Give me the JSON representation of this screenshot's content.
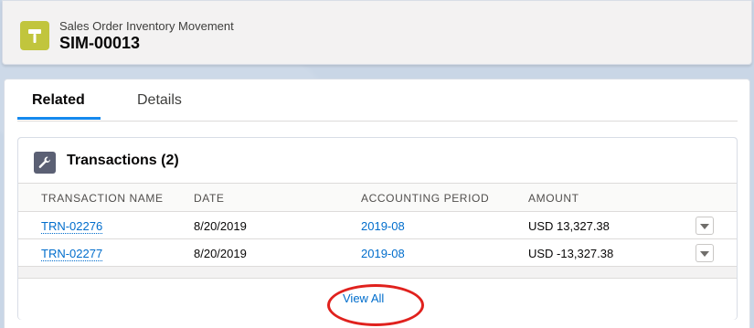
{
  "header": {
    "record_type": "Sales Order Inventory Movement",
    "record_name": "SIM-00013",
    "icon": "hammer-icon",
    "icon_color": "#c1c53d"
  },
  "tabs": [
    {
      "label": "Related",
      "active": true
    },
    {
      "label": "Details",
      "active": false
    }
  ],
  "related": {
    "title": "Transactions (2)",
    "icon": "wrench-icon",
    "columns": [
      "Transaction Name",
      "Date",
      "Accounting Period",
      "Amount"
    ],
    "rows": [
      {
        "name": "TRN-02276",
        "date": "8/20/2019",
        "period": "2019-08",
        "amount": "USD 13,327.38"
      },
      {
        "name": "TRN-02277",
        "date": "8/20/2019",
        "period": "2019-08",
        "amount": "USD -13,327.38"
      }
    ],
    "footer_link": "View All"
  },
  "colors": {
    "link": "#006dcc",
    "active_tab": "#1589ee",
    "annotation": "#e0211d"
  }
}
